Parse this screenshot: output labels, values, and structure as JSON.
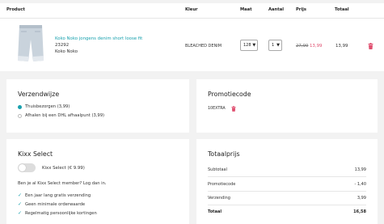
{
  "cart": {
    "headers": {
      "product": "Product",
      "color": "Kleur",
      "size": "Maat",
      "qty": "Aantal",
      "price": "Prijs",
      "total": "Totaal"
    },
    "item": {
      "name": "Koko Noko jongens denim short loose fit",
      "sku": "23292",
      "brand": "Koko Noko",
      "color": "BLEACHED DENIM",
      "size": "128",
      "qty": "1",
      "price_old": "27,99",
      "price_new": "13,99",
      "line_total": "13,99"
    }
  },
  "shipping": {
    "title": "Verzendwijze",
    "options": [
      {
        "label": "Thuisbezorgen (3,99)",
        "selected": true
      },
      {
        "label": "Afhalen bij een DHL afhaalpunt (3,99)",
        "selected": false
      }
    ]
  },
  "promo": {
    "title": "Promotiecode",
    "code": "10EXTRA"
  },
  "kixx": {
    "title": "Kixx Select",
    "toggle_label": "Kixx Select (€ 9.99)",
    "toggle_on": false,
    "member_text": "Ben je al Kixx Select member? Log dan in.",
    "benefits": [
      "Een jaar lang gratis verzending",
      "Geen minimale orderwaarde",
      "Regelmatig persoonlijke kortingen"
    ]
  },
  "summary": {
    "title": "Totaalprijs",
    "rows": [
      {
        "label": "Subtotaal",
        "value": "13,99"
      },
      {
        "label": "Promotiecode",
        "value": "- 1,40"
      },
      {
        "label": "Verzending",
        "value": "3,99"
      }
    ],
    "total_label": "Totaal",
    "total_value": "16,58"
  },
  "colors": {
    "accent": "#19a1ae",
    "sale": "#e05070",
    "delete": "#e05070",
    "background": "#f2f2f2"
  },
  "icons": {
    "delete": "trash-icon",
    "check": "check-icon",
    "dropdown": "chevron-down-icon"
  }
}
